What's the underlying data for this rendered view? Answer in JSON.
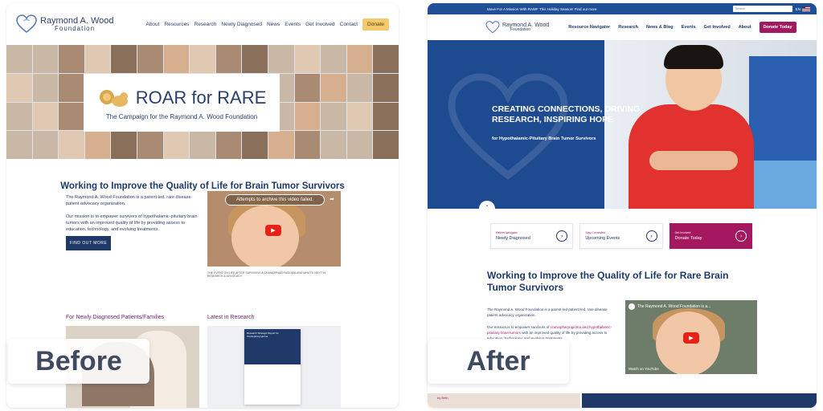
{
  "before": {
    "logo": {
      "line1": "Raymond A. Wood",
      "line2": "Foundation"
    },
    "menu": [
      "About",
      "Resources",
      "Research",
      "Newly Diagnosed",
      "News",
      "Events",
      "Get Involved",
      "Contact"
    ],
    "donate_label": "Donate",
    "banner": {
      "title": "ROAR for RARE",
      "subtitle": "The Campaign for the Raymond A. Wood Foundation"
    },
    "heading": "Working to Improve the Quality of Life for Brain Tumor Survivors",
    "intro_p1": "The Raymond A. Wood Foundation is a parent-led, rare disease patient advocacy organization.",
    "intro_p2": "Our mission is to empower survivors of hypothalamic-pituitary brain tumors with an improved quality of life by providing access to education, technology, and evolving treatments.",
    "button_label": "FIND OUT MORE",
    "video_message": "Attempts to archive this video failed.",
    "video_caption": "THE EVENT ON LIFE AFTER SURVIVING A CRANIOPHARYNGIOMA AND WHAT'S NEXT IN RESEARCH & ADVOCACY",
    "col1_heading": "For Newly Diagnosed Patients/Families",
    "col2_heading": "Latest in Research",
    "report_title": "Research Strategic Report for Craniopharyngioma"
  },
  "after": {
    "announcement": "Move For A Mission With RAWF This Holiday Season! Find out more",
    "search_placeholder": "Search",
    "lang": "EN",
    "logo": {
      "line1": "Raymond A. Wood",
      "line2": "Foundation"
    },
    "menu": [
      "Resource Navigator",
      "Research",
      "News & Blog",
      "Events",
      "Get Involved",
      "About"
    ],
    "donate_label": "Donate Today",
    "hero_title": "CREATING CONNECTIONS, DRIVING RESEARCH, INSPIRING HOPE",
    "hero_subtitle": "for Hypothalamic-Pituitary Brain Tumor Survivors",
    "cards": [
      {
        "small": "Patient Navigator",
        "big": "Newly Diagnosed"
      },
      {
        "small": "Stay Connected",
        "big": "Upcoming Events"
      },
      {
        "small": "Get Involved",
        "big": "Donate Today"
      }
    ],
    "heading": "Working to Improve the Quality of Life for Rare Brain Tumor Survivors",
    "intro_p1": "The Raymond A. Wood Foundation is a parent-led patient-led, rare disease patient advocacy organization.",
    "intro_p2_a": "Our mission is to empower survivors of ",
    "intro_p2_link": "craniopharyngioma and hypothalamic-pituitary brain tumors",
    "intro_p2_b": " with an improved quality of life by providing access to education, technology, and evolving treatments.",
    "video_title": "The Raymond A. Wood Foundation is a...",
    "watch_on": "Watch on YouTube",
    "bottom_label": "by Beth"
  },
  "labels": {
    "before": "Before",
    "after": "After"
  },
  "colors": {
    "navy": "#1f3a68",
    "magenta": "#a3185e",
    "gold": "#f4c96b",
    "hero_blue": "#1e4b8f"
  }
}
